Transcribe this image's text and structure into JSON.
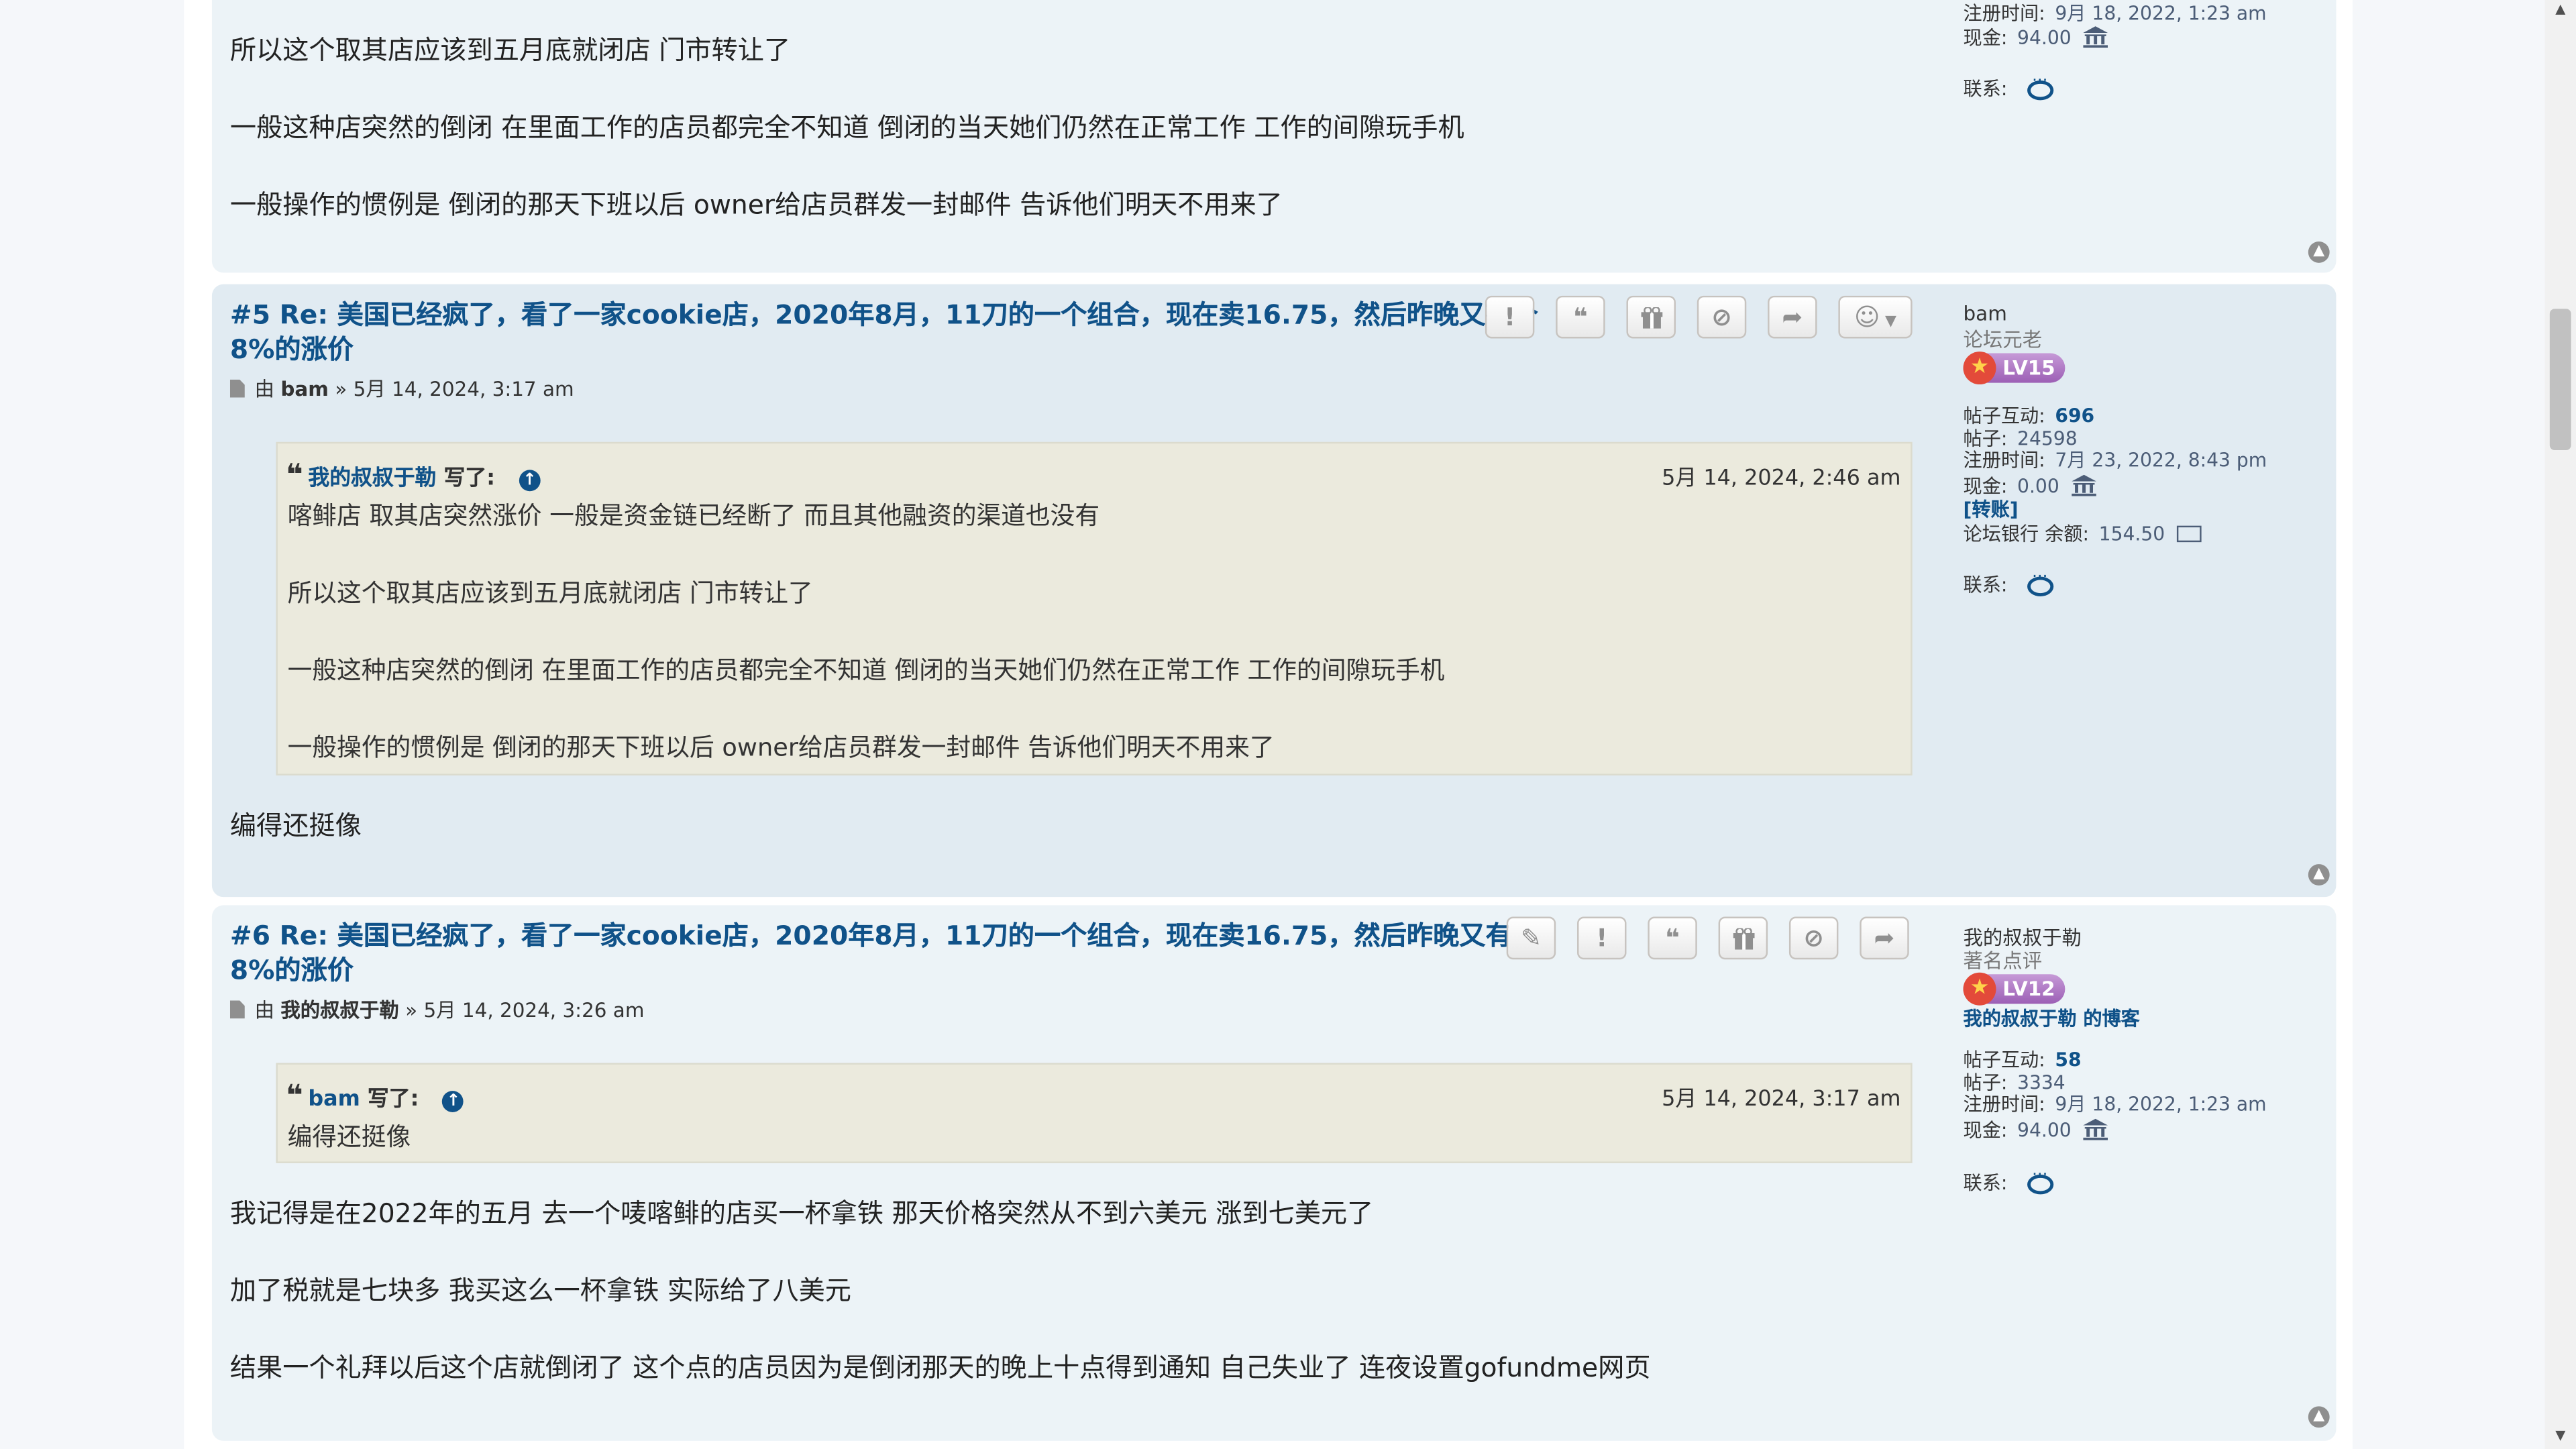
{
  "top_post": {
    "paragraphs": [
      "所以这个取其店应该到五月底就闭店 门市转让了",
      "一般这种店突然的倒闭 在里面工作的店员都完全不知道 倒闭的当天她们仍然在正常工作 工作的间隙玩手机",
      "一般操作的惯例是 倒闭的那天下班以后 owner给店员群发一封邮件 告诉他们明天不用来了"
    ],
    "profile": {
      "reg_label": "注册时间:",
      "reg_value": "9月 18, 2022, 1:23 am",
      "cash_label": "现金:",
      "cash_value": "94.00",
      "contact_label": "联系:"
    }
  },
  "post5": {
    "title_line1": "#5 Re: 美国已经疯了，看了一家cookie店，2020年8月，11刀的一个组合，现在卖16.75，然后昨晚又有个",
    "title_line2": "8%的涨价",
    "by_label": "由",
    "author": "bam",
    "date_sep": "»",
    "date": "5月 14, 2024, 3:17 am",
    "quote": {
      "author": "我的叔叔于勒",
      "wrote": "写了:",
      "date": "5月 14, 2024, 2:46 am",
      "paragraphs": [
        "喀鲱店 取其店突然涨价 一般是资金链已经断了 而且其他融资的渠道也没有",
        "所以这个取其店应该到五月底就闭店 门市转让了",
        "一般这种店突然的倒闭 在里面工作的店员都完全不知道 倒闭的当天她们仍然在正常工作 工作的间隙玩手机",
        "一般操作的惯例是 倒闭的那天下班以后 owner给店员群发一封邮件 告诉他们明天不用来了"
      ]
    },
    "body": "编得还挺像",
    "profile": {
      "username": "bam",
      "rank": "论坛元老",
      "level": "LV15",
      "interactions_label": "帖子互动:",
      "interactions_value": "696",
      "posts_label": "帖子:",
      "posts_value": "24598",
      "reg_label": "注册时间:",
      "reg_value": "7月 23, 2022, 8:43 pm",
      "cash_label": "现金:",
      "cash_value": "0.00",
      "transfer": "[转账]",
      "bank_label": "论坛银行 余额:",
      "bank_value": "154.50",
      "contact_label": "联系:"
    }
  },
  "post6": {
    "title_line1": "#6 Re: 美国已经疯了，看了一家cookie店，2020年8月，11刀的一个组合，现在卖16.75，然后昨晚又有个",
    "title_line2": "8%的涨价",
    "by_label": "由",
    "author": "我的叔叔于勒",
    "date_sep": "»",
    "date": "5月 14, 2024, 3:26 am",
    "quote": {
      "author": "bam",
      "wrote": "写了:",
      "date": "5月 14, 2024, 3:17 am",
      "paragraphs": [
        "编得还挺像"
      ]
    },
    "body": [
      "我记得是在2022年的五月 去一个唛喀鲱的店买一杯拿铁 那天价格突然从不到六美元 涨到七美元了",
      "加了税就是七块多 我买这么一杯拿铁 实际给了八美元",
      "结果一个礼拜以后这个店就倒闭了 这个点的店员因为是倒闭那天的晚上十点得到通知 自己失业了 连夜设置gofundme网页"
    ],
    "profile": {
      "username": "我的叔叔于勒",
      "rank": "著名点评",
      "level": "LV12",
      "blog": "我的叔叔于勒 的博客",
      "interactions_label": "帖子互动:",
      "interactions_value": "58",
      "posts_label": "帖子:",
      "posts_value": "3334",
      "reg_label": "注册时间:",
      "reg_value": "9月 18, 2022, 1:23 am",
      "cash_label": "现金:",
      "cash_value": "94.00",
      "contact_label": "联系:"
    }
  },
  "icons": {
    "report": "!",
    "quote": "❝",
    "gift": "gift-icon",
    "block": "⊘",
    "share": "➦",
    "react": "☺",
    "edit": "✎",
    "top": "▲"
  }
}
